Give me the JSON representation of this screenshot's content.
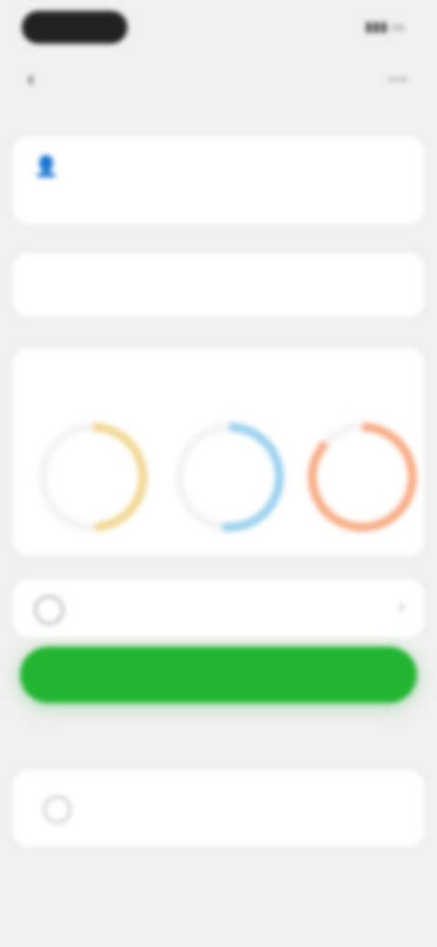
{
  "colors": {
    "background": "#f0f0f0",
    "card": "#ffffff",
    "cta": "#23b532",
    "gauge_yellow": "#f2d999",
    "gauge_blue": "#9fd3f0",
    "gauge_orange": "#f7b08a"
  },
  "icons": {
    "back": "back-icon",
    "menu": "menu-icon",
    "profile": "person-icon",
    "check": "check-icon"
  }
}
